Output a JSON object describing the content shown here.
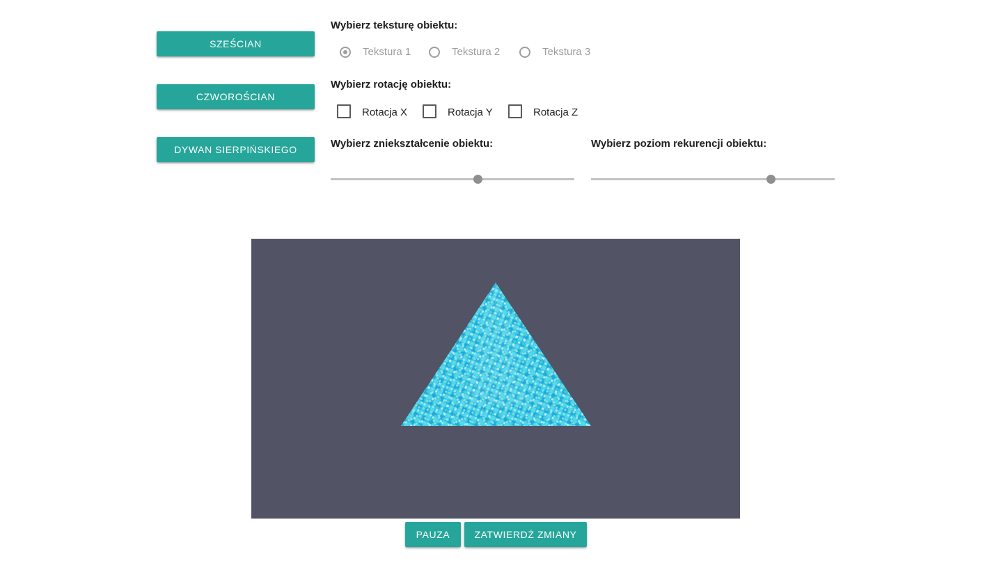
{
  "buttons": {
    "cube": "SZEŚCIAN",
    "tetrahedron": "CZWOROŚCIAN",
    "carpet": "DYWAN SIERPIŃSKIEGO",
    "pause": "PAUZA",
    "apply": "ZATWIERDŹ ZMIANY"
  },
  "texture": {
    "heading": "Wybierz teksturę obiektu:",
    "options": [
      {
        "label": "Tekstura 1",
        "checked": true
      },
      {
        "label": "Tekstura 2",
        "checked": false
      },
      {
        "label": "Tekstura 3",
        "checked": false
      }
    ]
  },
  "rotation": {
    "heading": "Wybierz rotację obiektu:",
    "options": [
      {
        "label": "Rotacja X",
        "checked": false
      },
      {
        "label": "Rotacja Y",
        "checked": false
      },
      {
        "label": "Rotacja Z",
        "checked": false
      }
    ]
  },
  "distortion": {
    "heading": "Wybierz zniekształcenie obiektu:",
    "value_fraction": 0.605
  },
  "recursion": {
    "heading": "Wybierz poziom rekurencji obiektu:",
    "value_fraction": 0.74
  },
  "colors": {
    "accent": "#26a69a",
    "canvas_bg": "#525466",
    "shape_fill": "#2bc0e4"
  }
}
